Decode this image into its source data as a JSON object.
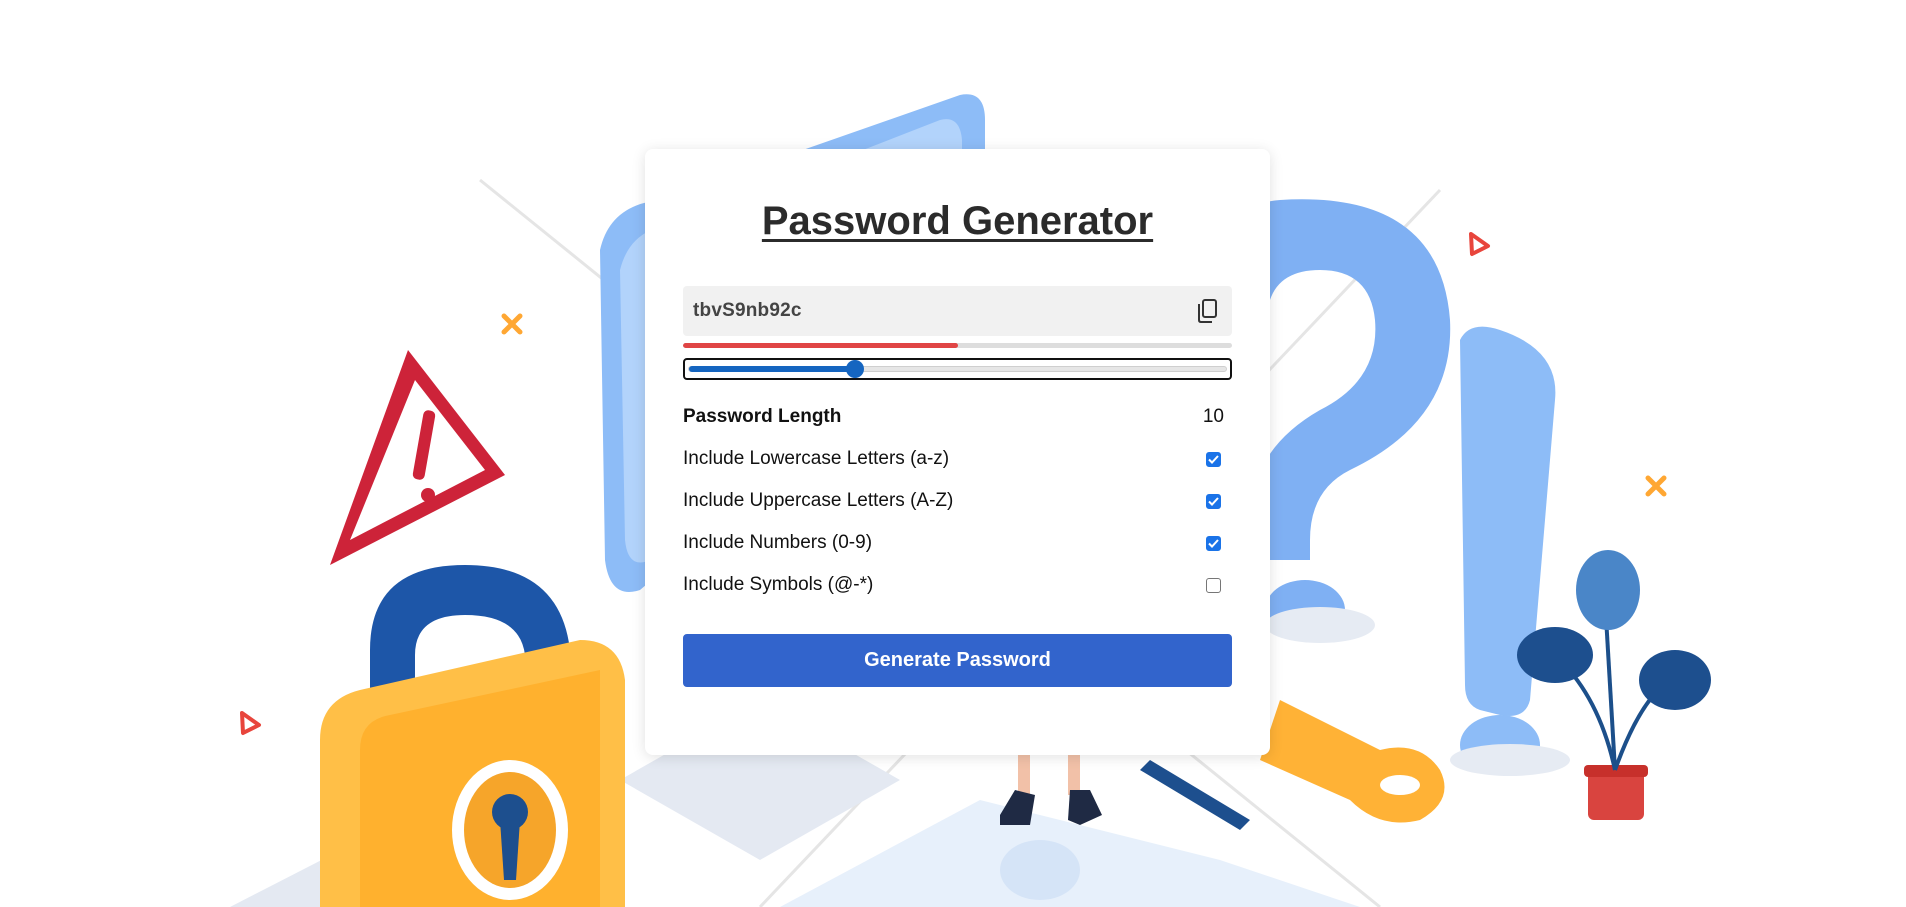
{
  "page": {
    "title": "Password Generator"
  },
  "password": {
    "value": "tbvS9nb92c",
    "copy_icon": "copy-icon"
  },
  "strength": {
    "fraction": 0.5,
    "color": "#e04545"
  },
  "length_slider": {
    "fraction": 0.31,
    "color": "#1565c0"
  },
  "settings": {
    "length_label": "Password Length",
    "length_value": "10",
    "options": [
      {
        "label": "Include Lowercase Letters (a-z)",
        "checked": true
      },
      {
        "label": "Include Uppercase Letters (A-Z)",
        "checked": true
      },
      {
        "label": "Include Numbers (0-9)",
        "checked": true
      },
      {
        "label": "Include Symbols (@-*)",
        "checked": false
      }
    ]
  },
  "generate": {
    "label": "Generate Password",
    "color": "#3264cc"
  }
}
